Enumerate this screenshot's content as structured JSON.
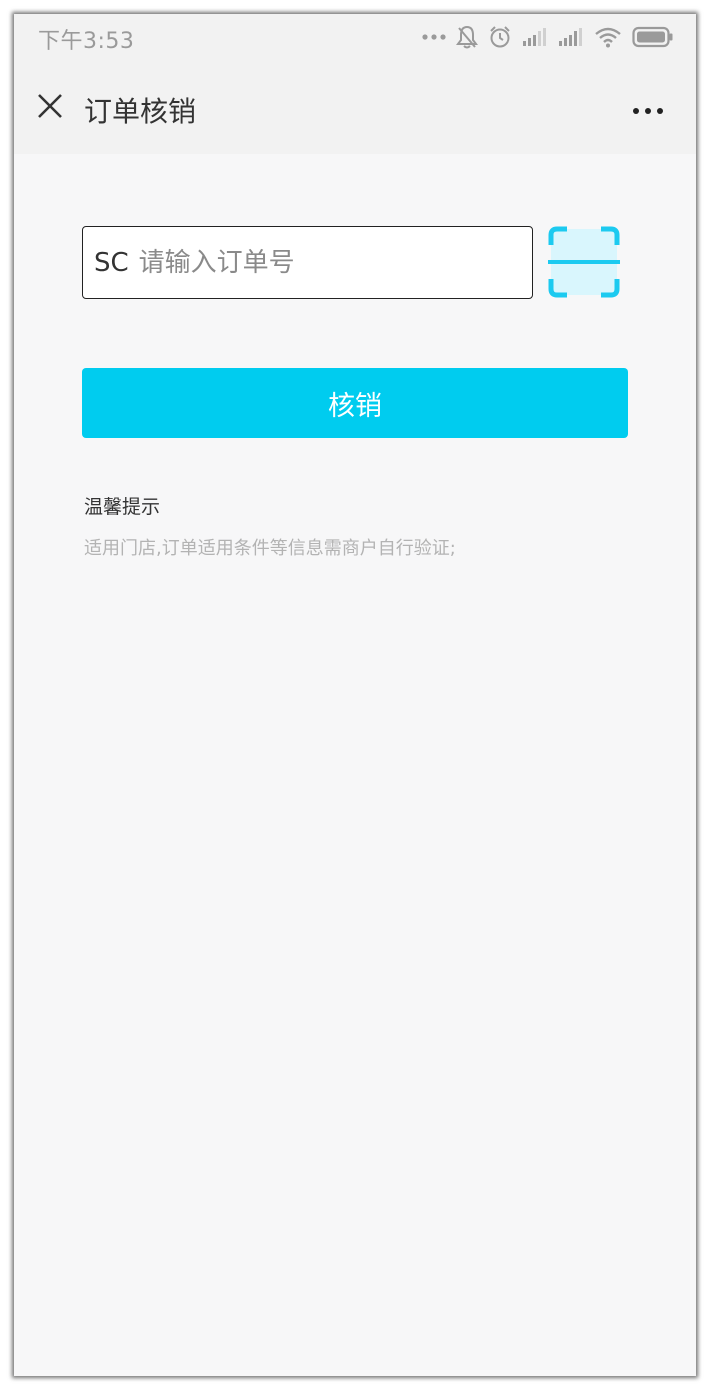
{
  "status_bar": {
    "time": "下午3:53",
    "icons": [
      "more-dots-icon",
      "bell-off-icon",
      "alarm-icon",
      "signal-icon",
      "signal-icon",
      "wifi-icon",
      "battery-icon"
    ]
  },
  "nav": {
    "title": "订单核销",
    "close_icon": "close-icon",
    "more_icon": "more-icon"
  },
  "order": {
    "prefix": "SC",
    "placeholder": "请输入订单号",
    "value": "",
    "scan_icon": "scan-icon"
  },
  "verify_button": {
    "label": "核销"
  },
  "tips": {
    "title": "温馨提示",
    "text": "适用门店,订单适用条件等信息需商户自行验证;"
  },
  "colors": {
    "accent": "#00ccef",
    "scan_fill": "#d9f6fd",
    "background": "#f7f7f8",
    "header": "#f2f2f2"
  }
}
